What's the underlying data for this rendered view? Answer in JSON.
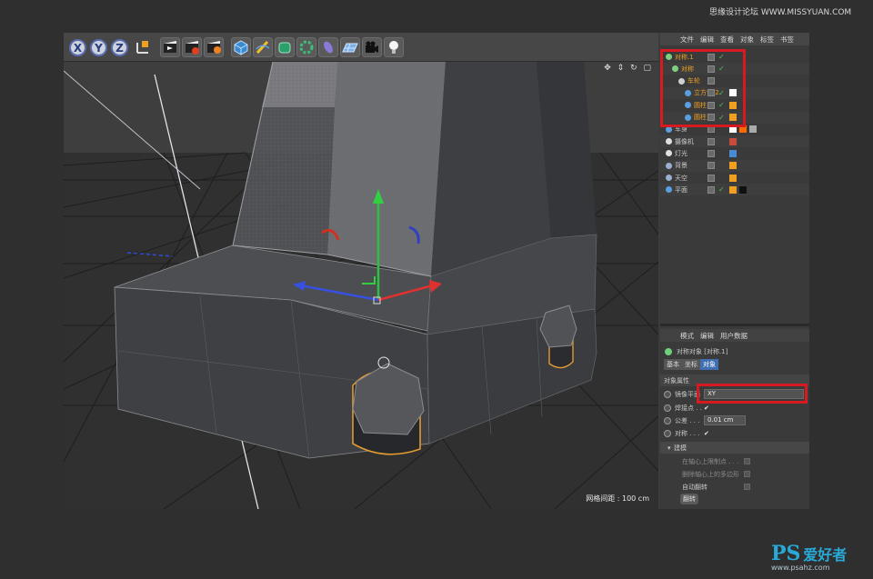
{
  "watermark_top": "思缘设计论坛 WWW.MISSYUAN.COM",
  "watermark_bottom": {
    "logo": "PS",
    "name": "爱好者",
    "url": "www.psahz.com"
  },
  "toolbar": {
    "axis_buttons": [
      "X",
      "Y",
      "Z"
    ],
    "icons": [
      "coordinate-system-icon",
      "render-view-icon",
      "render-picture-queue-icon",
      "render-settings-icon",
      "cube-icon",
      "pen-spline-icon",
      "subdivision-icon",
      "array-icon",
      "deformer-icon",
      "floor-icon",
      "camera-icon",
      "light-icon"
    ]
  },
  "viewport": {
    "grid_label": "网格间距 : 100 cm",
    "nav_icons": "✥ ⇕ ↻ ▢"
  },
  "object_manager": {
    "menu": [
      "文件",
      "编辑",
      "查看",
      "对象",
      "标签",
      "书签"
    ],
    "objects": [
      {
        "name": "对称.1",
        "indent": 0,
        "selected": true,
        "check": true,
        "icon_color": "#7ed07e"
      },
      {
        "name": "对称",
        "indent": 1,
        "selected": true,
        "check": true,
        "icon_color": "#7ed07e"
      },
      {
        "name": "车轮",
        "indent": 2,
        "selected": true,
        "check": false,
        "icon_color": "#d0d0d0"
      },
      {
        "name": "立方体.2",
        "indent": 3,
        "selected": true,
        "check": true,
        "icon_color": "#5aa0e0"
      },
      {
        "name": "圆柱.1",
        "indent": 3,
        "selected": true,
        "check": true,
        "icon_color": "#5aa0e0"
      },
      {
        "name": "圆柱",
        "indent": 3,
        "selected": true,
        "check": true,
        "icon_color": "#5aa0e0"
      },
      {
        "name": "车身",
        "indent": 0,
        "selected": false,
        "check": false,
        "icon_color": "#5aa0e0"
      },
      {
        "name": "摄像机",
        "indent": 0,
        "selected": false,
        "check": false,
        "icon_color": "#e0e0e0"
      },
      {
        "name": "灯光",
        "indent": 0,
        "selected": false,
        "check": false,
        "icon_color": "#e0e0e0"
      },
      {
        "name": "背景",
        "indent": 0,
        "selected": false,
        "check": false,
        "icon_color": "#9ab0d0"
      },
      {
        "name": "天空",
        "indent": 0,
        "selected": false,
        "check": false,
        "icon_color": "#9ab0d0"
      },
      {
        "name": "平面",
        "indent": 0,
        "selected": false,
        "check": true,
        "icon_color": "#5aa0e0"
      }
    ]
  },
  "attributes": {
    "menu": [
      "模式",
      "编辑",
      "用户数据"
    ],
    "object_title": "对称对象 [对称.1]",
    "tabs": [
      "基本",
      "坐标",
      "对象"
    ],
    "active_tab": "对象",
    "section": "对象属性",
    "fields": [
      {
        "label": "镜像平面",
        "value": "XY"
      },
      {
        "label": "焊接点 . .",
        "value": "✔"
      },
      {
        "label": "公差 . . .",
        "value": "0.01 cm"
      },
      {
        "label": "对称 . . .",
        "value": "✔"
      }
    ],
    "subsection": "建模",
    "sub_options": [
      "在轴心上限制点 . . .",
      "删除轴心上的多边形",
      "自动翻转"
    ],
    "flip_button": "翻转"
  }
}
